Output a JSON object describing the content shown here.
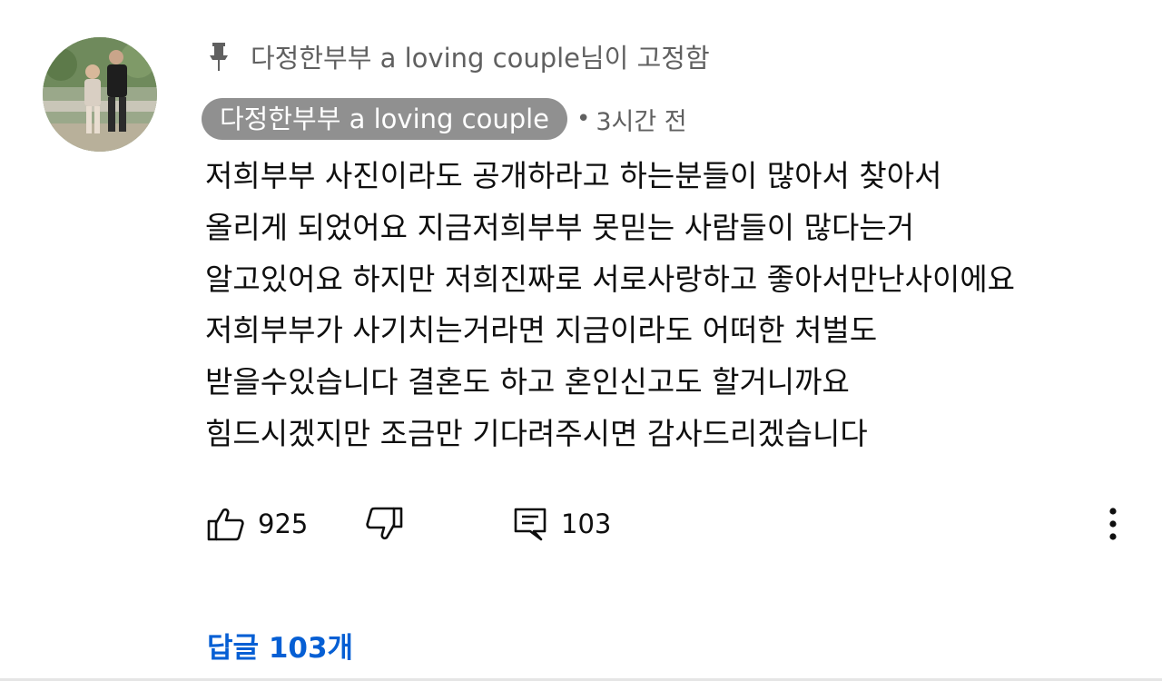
{
  "pinned": {
    "icon": "pin-icon",
    "text": "다정한부부 a loving couple님이 고정함"
  },
  "comment": {
    "avatar_icon": "avatar",
    "author": "다정한부부 a loving couple",
    "separator": "•",
    "time": "3시간 전",
    "lines": [
      "저희부부 사진이라도 공개하라고 하는분들이 많아서 찾아서",
      "올리게 되었어요 지금저희부부 못믿는 사람들이 많다는거",
      "알고있어요 하지만 저희진짜로 서로사랑하고 좋아서만난사이에요",
      "저희부부가 사기치는거라면 지금이라도 어떠한 처벌도",
      "받을수있습니다 결혼도 하고 혼인신고도 할거니까요",
      "힘드시겠지만 조금만 기다려주시면 감사드리겠습니다"
    ]
  },
  "actions": {
    "like_icon": "thumbs-up-icon",
    "like_count": "925",
    "dislike_icon": "thumbs-down-icon",
    "reply_icon": "reply-comment-icon",
    "reply_count": "103",
    "more_icon": "more-vert-icon"
  },
  "replies_link": "답글 103개",
  "colors": {
    "link": "#065fd4",
    "chip": "#909090",
    "secondary_text": "#606060"
  }
}
